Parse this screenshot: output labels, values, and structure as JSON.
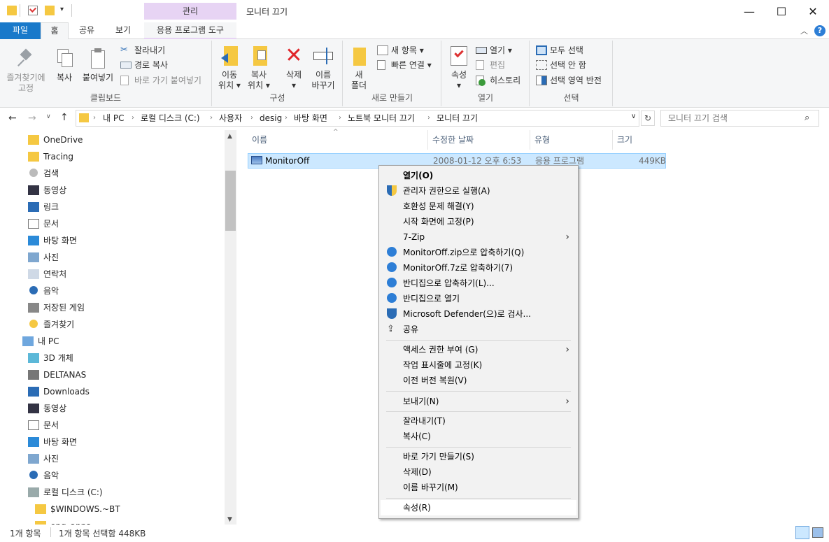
{
  "window": {
    "context_tab": "관리",
    "title": "모니터 끄기",
    "minimize": "—",
    "maximize": "☐",
    "close": "✕"
  },
  "ribbon_tabs": {
    "file": "파일",
    "home": "홈",
    "share": "공유",
    "view": "보기",
    "app_tools": "응용 프로그램 도구"
  },
  "ribbon": {
    "clipboard": {
      "label": "클립보드",
      "pin_l1": "즐겨찾기에",
      "pin_l2": "고정",
      "copy": "복사",
      "paste": "붙여넣기",
      "cut": "잘라내기",
      "copy_path": "경로 복사",
      "paste_shortcut": "바로 가기 붙여넣기"
    },
    "organize": {
      "label": "구성",
      "move_l1": "이동",
      "move_l2": "위치 ▾",
      "copyto_l1": "복사",
      "copyto_l2": "위치 ▾",
      "delete_l1": "삭제",
      "delete_l2": "▾",
      "rename_l1": "이름",
      "rename_l2": "바꾸기"
    },
    "new": {
      "label": "새로 만들기",
      "folder_l1": "새",
      "folder_l2": "폴더",
      "new_item": "새 항목 ▾",
      "easy_access": "빠른 연결 ▾"
    },
    "open": {
      "label": "열기",
      "props_l1": "속성",
      "props_l2": "▾",
      "open": "열기 ▾",
      "edit": "편집",
      "history": "히스토리"
    },
    "select": {
      "label": "선택",
      "all": "모두 선택",
      "none": "선택 안 함",
      "invert": "선택 영역 반전"
    }
  },
  "address": {
    "crumbs": [
      "내 PC",
      "로컬 디스크 (C:)",
      "사용자",
      "desig",
      "바탕 화면",
      "노트북 모니터 끄기",
      "모니터 끄기"
    ],
    "search_placeholder": "모니터 끄기 검색"
  },
  "nav": {
    "items": [
      {
        "label": "OneDrive",
        "icon": "folder-icon"
      },
      {
        "label": "Tracing",
        "icon": "folder-icon"
      },
      {
        "label": "검색",
        "icon": "search-icon"
      },
      {
        "label": "동영상",
        "icon": "video-icon"
      },
      {
        "label": "링크",
        "icon": "link-icon"
      },
      {
        "label": "문서",
        "icon": "document-icon"
      },
      {
        "label": "바탕 화면",
        "icon": "desktop-icon"
      },
      {
        "label": "사진",
        "icon": "picture-icon"
      },
      {
        "label": "연락처",
        "icon": "contacts-icon"
      },
      {
        "label": "음악",
        "icon": "music-icon"
      },
      {
        "label": "저장된 게임",
        "icon": "game-icon"
      },
      {
        "label": "즐겨찾기",
        "icon": "star-icon"
      },
      {
        "label": "내 PC",
        "icon": "pc-icon"
      },
      {
        "label": "3D 개체",
        "icon": "cube-icon"
      },
      {
        "label": "DELTANAS",
        "icon": "nas-icon"
      },
      {
        "label": "Downloads",
        "icon": "download-icon"
      },
      {
        "label": "동영상",
        "icon": "video-icon"
      },
      {
        "label": "문서",
        "icon": "document-icon"
      },
      {
        "label": "바탕 화면",
        "icon": "desktop-icon"
      },
      {
        "label": "사진",
        "icon": "picture-icon"
      },
      {
        "label": "음악",
        "icon": "music-icon"
      },
      {
        "label": "로컬 디스크 (C:)",
        "icon": "drive-icon"
      },
      {
        "label": "$WINDOWS.~BT",
        "icon": "folder-icon"
      },
      {
        "label": "eng_apps",
        "icon": "folder-icon"
      }
    ]
  },
  "columns": {
    "name": "이름",
    "date": "수정한 날짜",
    "type": "유형",
    "size": "크기"
  },
  "file": {
    "name": "MonitorOff",
    "date": "2008-01-12 오후 6:53",
    "type": "응용 프로그램",
    "size": "449KB"
  },
  "context_menu": {
    "open": "열기(O)",
    "run_admin": "관리자 권한으로 실행(A)",
    "compat": "호환성 문제 해결(Y)",
    "pin_start": "시작 화면에 고정(P)",
    "zip7": "7-Zip",
    "bandizip_zip": "MonitorOff.zip으로 압축하기(Q)",
    "bandizip_7z": "MonitorOff.7z로 압축하기(7)",
    "bandizip_compress": "반디집으로 압축하기(L)...",
    "bandizip_open": "반디집으로 열기",
    "defender": "Microsoft Defender(으)로 검사...",
    "share": "공유",
    "give_access": "액세스 권한 부여 (G)",
    "pin_taskbar": "작업 표시줄에 고정(K)",
    "restore": "이전 버전 복원(V)",
    "send_to": "보내기(N)",
    "cut": "잘라내기(T)",
    "copy": "복사(C)",
    "shortcut": "바로 가기 만들기(S)",
    "delete": "삭제(D)",
    "rename": "이름 바꾸기(M)",
    "properties": "속성(R)"
  },
  "status": {
    "count": "1개 항목",
    "selected": "1개 항목 선택함 448KB"
  },
  "colors": {
    "accent": "#1979ca",
    "selection": "#cce8ff",
    "context_tab": "#e7d4f4"
  }
}
